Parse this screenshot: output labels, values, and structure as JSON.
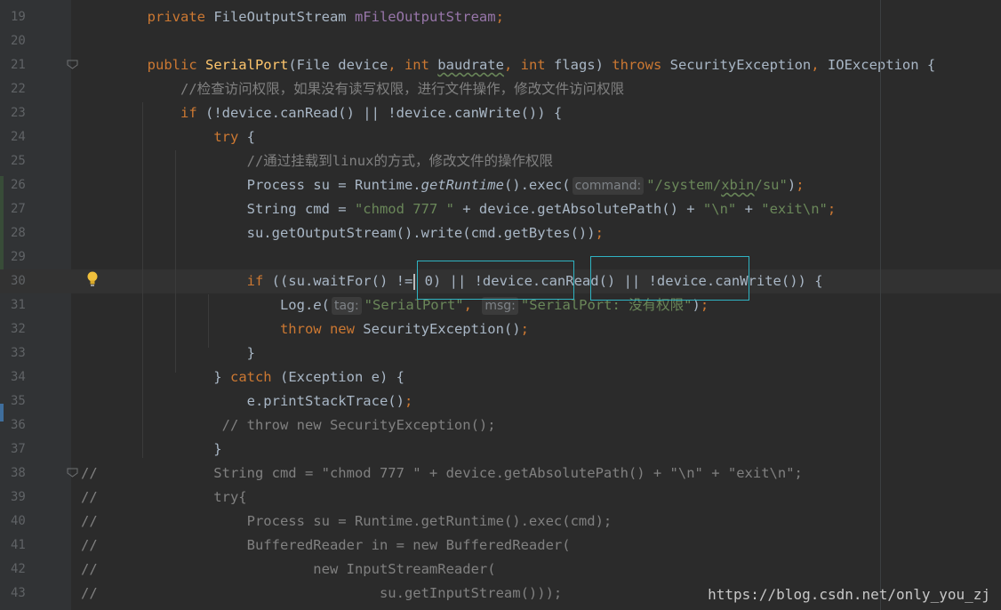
{
  "editor": {
    "lines": [
      {
        "num": "19",
        "tokens": [
          {
            "t": "        "
          },
          {
            "t": "private ",
            "c": "kw"
          },
          {
            "t": "FileOutputStream "
          },
          {
            "t": "mFileOutputStream",
            "c": "fld"
          },
          {
            "t": ";",
            "c": "kw"
          }
        ]
      },
      {
        "num": "20",
        "tokens": []
      },
      {
        "num": "21",
        "tokens": [
          {
            "t": "        "
          },
          {
            "t": "public ",
            "c": "kw"
          },
          {
            "t": "SerialPort",
            "c": "fn"
          },
          {
            "t": "(File device"
          },
          {
            "t": ", ",
            "c": "kw"
          },
          {
            "t": "int ",
            "c": "kw"
          },
          {
            "t": "baudrate",
            "c": "wavy"
          },
          {
            "t": ", ",
            "c": "kw"
          },
          {
            "t": "int ",
            "c": "kw"
          },
          {
            "t": "flags) "
          },
          {
            "t": "throws ",
            "c": "kw"
          },
          {
            "t": "SecurityException"
          },
          {
            "t": ", ",
            "c": "kw"
          },
          {
            "t": "IOException {"
          }
        ]
      },
      {
        "num": "22",
        "tokens": [
          {
            "t": "            "
          },
          {
            "t": "//检查访问权限，如果没有读写权限，进行文件操作，修改文件访问权限",
            "c": "cmt"
          }
        ]
      },
      {
        "num": "23",
        "tokens": [
          {
            "t": "            "
          },
          {
            "t": "if ",
            "c": "kw"
          },
          {
            "t": "(!device.canRead() || !device.canWrite()) {"
          }
        ]
      },
      {
        "num": "24",
        "tokens": [
          {
            "t": "                "
          },
          {
            "t": "try ",
            "c": "kw"
          },
          {
            "t": "{"
          }
        ]
      },
      {
        "num": "25",
        "tokens": [
          {
            "t": "                    "
          },
          {
            "t": "//通过挂载到linux的方式，修改文件的操作权限",
            "c": "cmt"
          }
        ]
      },
      {
        "num": "26",
        "tokens": [
          {
            "t": "                    Process su = Runtime."
          },
          {
            "t": "getRuntime",
            "c": "ital"
          },
          {
            "t": "().exec("
          },
          {
            "hint": "command:"
          },
          {
            "t": "\"/system/",
            "c": "str"
          },
          {
            "t": "xbin",
            "c": "str wavy"
          },
          {
            "t": "/su\"",
            "c": "str"
          },
          {
            "t": ")"
          },
          {
            "t": ";",
            "c": "kw"
          }
        ]
      },
      {
        "num": "27",
        "tokens": [
          {
            "t": "                    String cmd = "
          },
          {
            "t": "\"chmod 777 \"",
            "c": "str"
          },
          {
            "t": " + device.getAbsolutePath() + "
          },
          {
            "t": "\"\\n\"",
            "c": "str"
          },
          {
            "t": " + "
          },
          {
            "t": "\"exit\\n\"",
            "c": "str"
          },
          {
            "t": ";",
            "c": "kw"
          }
        ]
      },
      {
        "num": "28",
        "tokens": [
          {
            "t": "                    su.getOutputStream().write(cmd.getBytes())"
          },
          {
            "t": ";",
            "c": "kw"
          }
        ]
      },
      {
        "num": "29",
        "tokens": []
      },
      {
        "num": "30",
        "current": true,
        "tokens": [
          {
            "t": "                    "
          },
          {
            "t": "if ",
            "c": "kw"
          },
          {
            "t": "((su.waitFor() !="
          },
          {
            "cursor": true
          },
          {
            "t": " 0) || !device.canRead() || !device.canWrite()) {"
          }
        ]
      },
      {
        "num": "31",
        "tokens": [
          {
            "t": "                        Log."
          },
          {
            "t": "e",
            "c": "ital"
          },
          {
            "t": "("
          },
          {
            "hint": "tag:"
          },
          {
            "t": "\"SerialPort\"",
            "c": "str"
          },
          {
            "t": ", ",
            "c": "kw"
          },
          {
            "hint": "msg:"
          },
          {
            "t": "\"SerialPort: 没有权限\"",
            "c": "str"
          },
          {
            "t": ")"
          },
          {
            "t": ";",
            "c": "kw"
          }
        ]
      },
      {
        "num": "32",
        "tokens": [
          {
            "t": "                        "
          },
          {
            "t": "throw new ",
            "c": "kw"
          },
          {
            "t": "SecurityException()"
          },
          {
            "t": ";",
            "c": "kw"
          }
        ]
      },
      {
        "num": "33",
        "tokens": [
          {
            "t": "                    }"
          }
        ]
      },
      {
        "num": "34",
        "tokens": [
          {
            "t": "                } "
          },
          {
            "t": "catch ",
            "c": "kw"
          },
          {
            "t": "(Exception e) {"
          }
        ]
      },
      {
        "num": "35",
        "tokens": [
          {
            "t": "                    e.printStackTrace()"
          },
          {
            "t": ";",
            "c": "kw"
          }
        ]
      },
      {
        "num": "36",
        "tokens": [
          {
            "t": "                 "
          },
          {
            "t": "// throw new SecurityException();",
            "c": "cmt"
          }
        ]
      },
      {
        "num": "37",
        "tokens": [
          {
            "t": "                }"
          }
        ]
      },
      {
        "num": "38",
        "tokens": [
          {
            "t": "//              String cmd = \"chmod 777 \" + device.getAbsolutePath() + \"\\n\" + \"exit\\n\";",
            "c": "cmt"
          }
        ]
      },
      {
        "num": "39",
        "tokens": [
          {
            "t": "//              try{",
            "c": "cmt"
          }
        ]
      },
      {
        "num": "40",
        "tokens": [
          {
            "t": "//                  Process su = Runtime.getRuntime().exec(cmd);",
            "c": "cmt"
          }
        ]
      },
      {
        "num": "41",
        "tokens": [
          {
            "t": "//                  BufferedReader in = new BufferedReader(",
            "c": "cmt"
          }
        ]
      },
      {
        "num": "42",
        "tokens": [
          {
            "t": "//                          new InputStreamReader(",
            "c": "cmt"
          }
        ]
      },
      {
        "num": "43",
        "tokens": [
          {
            "t": "//                                  su.getInputStream()));",
            "c": "cmt"
          }
        ]
      }
    ]
  },
  "watermark": "https://blog.csdn.net/only_you_zj",
  "colors": {
    "background": "#2b2b2b",
    "keyword": "#cc7832",
    "string": "#6a8759",
    "comment": "#808080",
    "field": "#9876aa",
    "method_decl": "#ffc66d",
    "highlight_box": "#2fb3c2"
  },
  "icons": {
    "bulb": "lightbulb-icon",
    "fold": "fold-marker-icon"
  }
}
